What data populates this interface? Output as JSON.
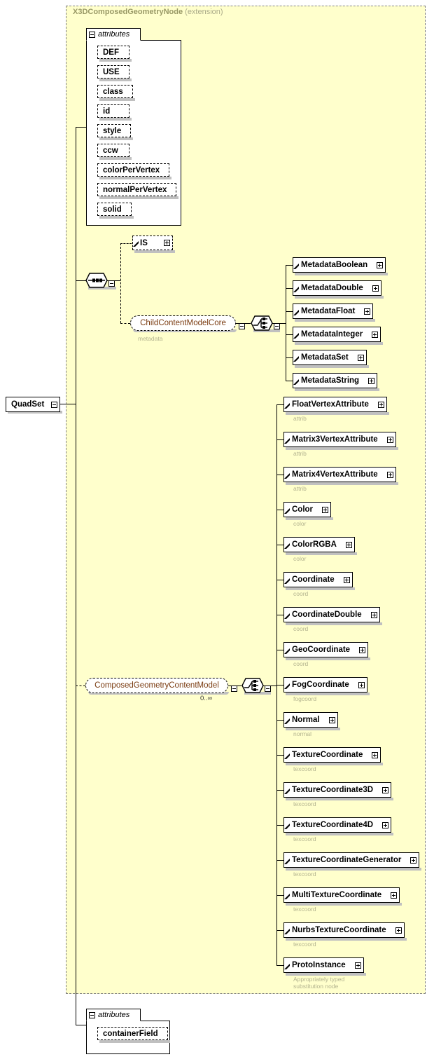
{
  "diagram": {
    "kind": "xml-schema-element-diagram",
    "root_element": "QuadSet",
    "extension_label": "X3DComposedGeometryNode",
    "extension_kind": "(extension)",
    "attributes_label": "attributes",
    "inherited_attributes": [
      "DEF",
      "USE",
      "class",
      "id",
      "style",
      "ccw",
      "colorPerVertex",
      "normalPerVertex",
      "solid"
    ],
    "own_attributes": [
      "containerField"
    ],
    "compositors": {
      "sequence": "sequence-compositor",
      "choice": "choice-compositor"
    },
    "groups": [
      {
        "name": "ChildContentModelCore",
        "caption": "metadata",
        "occurs": "",
        "children": [
          "MetadataBoolean",
          "MetadataDouble",
          "MetadataFloat",
          "MetadataInteger",
          "MetadataSet",
          "MetadataString"
        ]
      },
      {
        "name": "ComposedGeometryContentModel",
        "caption": "",
        "occurs": "0..∞",
        "children": [
          "FloatVertexAttribute",
          "Matrix3VertexAttribute",
          "Matrix4VertexAttribute",
          "Color",
          "ColorRGBA",
          "Coordinate",
          "CoordinateDouble",
          "GeoCoordinate",
          "FogCoordinate",
          "Normal",
          "TextureCoordinate",
          "TextureCoordinate3D",
          "TextureCoordinate4D",
          "TextureCoordinateGenerator",
          "MultiTextureCoordinate",
          "NurbsTextureCoordinate",
          "ProtoInstance"
        ]
      }
    ],
    "is_node": "IS",
    "metadata_children": [
      {
        "label": "MetadataBoolean",
        "caption": ""
      },
      {
        "label": "MetadataDouble",
        "caption": ""
      },
      {
        "label": "MetadataFloat",
        "caption": ""
      },
      {
        "label": "MetadataInteger",
        "caption": ""
      },
      {
        "label": "MetadataSet",
        "caption": ""
      },
      {
        "label": "MetadataString",
        "caption": ""
      }
    ],
    "geometry_children": [
      {
        "label": "FloatVertexAttribute",
        "caption": "attrib"
      },
      {
        "label": "Matrix3VertexAttribute",
        "caption": "attrib"
      },
      {
        "label": "Matrix4VertexAttribute",
        "caption": "attrib"
      },
      {
        "label": "Color",
        "caption": "color"
      },
      {
        "label": "ColorRGBA",
        "caption": "color"
      },
      {
        "label": "Coordinate",
        "caption": "coord"
      },
      {
        "label": "CoordinateDouble",
        "caption": "coord"
      },
      {
        "label": "GeoCoordinate",
        "caption": "coord"
      },
      {
        "label": "FogCoordinate",
        "caption": "fogcoord"
      },
      {
        "label": "Normal",
        "caption": "normal"
      },
      {
        "label": "TextureCoordinate",
        "caption": "texcoord"
      },
      {
        "label": "TextureCoordinate3D",
        "caption": "texcoord"
      },
      {
        "label": "TextureCoordinate4D",
        "caption": "texcoord"
      },
      {
        "label": "TextureCoordinateGenerator",
        "caption": "texcoord"
      },
      {
        "label": "MultiTextureCoordinate",
        "caption": "texcoord"
      },
      {
        "label": "NurbsTextureCoordinate",
        "caption": "texcoord"
      },
      {
        "label": "ProtoInstance",
        "caption": "Appropriately typed\nsubstitution node"
      }
    ],
    "colors": {
      "extension_background": "#ffffcc",
      "extension_border": "#808080",
      "box_background": "#ffffff",
      "box_border": "#000000",
      "reference_text": "#7a3b10",
      "caption_text": "#b3b38f",
      "title_text": "#999966",
      "shadow": "#c0c0c0"
    }
  }
}
